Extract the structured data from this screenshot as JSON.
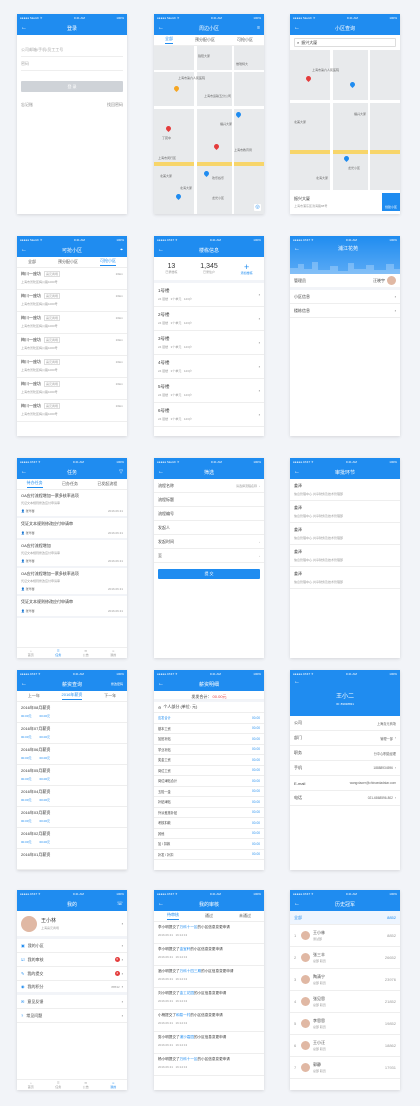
{
  "status": {
    "carrier_a": "●●●●● Sketch ✈",
    "carrier_b": "●●●●● AT&T ✈",
    "time": "9:41 AM",
    "battery": "100%"
  },
  "login": {
    "title": "登录",
    "account_placeholder": "公司邮箱/手机/员工工号",
    "password_placeholder": "密码",
    "login": "登 录",
    "forgot": "忘记账",
    "retrieve": "找回密码"
  },
  "nearby": {
    "title": "周边小区",
    "tabs": [
      "全部",
      "预分配小区",
      "可抢小区"
    ],
    "map_labels": [
      "上海市第六人民医院",
      "上海市运输五分公司",
      "丁苑中",
      "福兴大厦",
      "上海市闵行区",
      "欢乐谷乐",
      "北海大厦",
      "龙光小区",
      "锦阳大厦",
      "上海市教育局",
      "北美大厦",
      "维瑞特大"
    ]
  },
  "search": {
    "title": "小区查询",
    "query": "振兴大厦",
    "map_labels": [
      "上海市第六人民医院",
      "北美大厦",
      "龙光小区",
      "福兴大厦",
      "北海大厦"
    ],
    "result_name": "振兴大厦",
    "result_addr": "上海市浦东区滨海路88号",
    "create": "创建小区"
  },
  "grab": {
    "title": "可抢小区",
    "tabs": [
      "全部",
      "预分配小区",
      "可抢小区"
    ],
    "items": [
      {
        "name": "梅川一座坊",
        "tag": "喜元商场",
        "dist": "16km",
        "addr": "上海市普陀区梅川路1000号"
      },
      {
        "name": "梅川一座坊",
        "tag": "喜元商场",
        "dist": "16km",
        "addr": "上海市普陀区梅川路1000号"
      },
      {
        "name": "梅川一座坊",
        "tag": "喜元商场",
        "dist": "16km",
        "addr": "上海市普陀区梅川路1000号"
      },
      {
        "name": "梅川一座坊",
        "tag": "喜元商场",
        "dist": "16km",
        "addr": "上海市普陀区梅川路1000号"
      },
      {
        "name": "梅川一座坊",
        "tag": "喜元商场",
        "dist": "16km",
        "addr": "上海市普陀区梅川路1000号"
      },
      {
        "name": "梅川一座坊",
        "tag": "喜元商场",
        "dist": "16km",
        "addr": "上海市普陀区梅川路1000号"
      },
      {
        "name": "梅川一座坊",
        "tag": "喜元商场",
        "dist": "16km",
        "addr": "上海市普陀区梅川路1000号"
      }
    ]
  },
  "building": {
    "title": "楼栋信息",
    "stats": [
      {
        "n": "13",
        "l": "已录楼栋"
      },
      {
        "n": "1,345",
        "l": "已录住户"
      }
    ],
    "add": "添加楼栋",
    "rows": [
      {
        "name": "1号楼",
        "meta": "24 层楼   3个单元   123户"
      },
      {
        "name": "2号楼",
        "meta": "24 层楼   3个单元   123户"
      },
      {
        "name": "3号楼",
        "meta": "24 层楼   3个单元   123户"
      },
      {
        "name": "4号楼",
        "meta": "24 层楼   3个单元   123户"
      },
      {
        "name": "5号楼",
        "meta": "24 层楼   3个单元   123户"
      },
      {
        "name": "6号楼",
        "meta": "24 层楼   3个单元   123户"
      }
    ]
  },
  "estate": {
    "title": "浦江花苑",
    "manager_label": "管理员",
    "manager": "汪晓宇",
    "items": [
      "小区信息",
      "楼栋信息"
    ]
  },
  "tasks": {
    "title": "任务",
    "tabs": [
      "待办任务",
      "已办任务",
      "已发起流程"
    ],
    "items": [
      {
        "title": "OA应付流程增加一票多核率选项",
        "desc": "凭证文本规则修改应付申请审",
        "user": "张华馨",
        "date": "2016.06.31"
      },
      {
        "title": "凭证文本规则修改应付申请审",
        "desc": "",
        "user": "张华馨",
        "date": "2016.06.31"
      },
      {
        "title": "OA应付流程增加",
        "desc": "凭证文本规则修改应付申请审",
        "user": "张华馨",
        "date": "2016.06.31"
      },
      {
        "title": "OA应付流程增加一票多核率选项",
        "desc": "凭证文本规则修改应付申请审",
        "user": "张华馨",
        "date": "2016.06.31"
      },
      {
        "title": "凭证文本规则修改应付申请审",
        "desc": "",
        "user": "张华馨",
        "date": "2016.06.31"
      }
    ],
    "bar": [
      "首页",
      "任务",
      "公告",
      "我的"
    ]
  },
  "filter": {
    "title": "筛选",
    "fields": [
      {
        "l": "流程名称",
        "v": "请选择流程名称"
      },
      {
        "l": "流程标题",
        "v": ""
      },
      {
        "l": "流程编号",
        "v": ""
      },
      {
        "l": "发起人",
        "v": ""
      },
      {
        "l": "发起时间",
        "v": ""
      },
      {
        "l": "至",
        "v": ""
      }
    ],
    "confirm": "提 交"
  },
  "approval": {
    "title": "审批环节",
    "items": [
      {
        "n": "姜泽",
        "d": "信息管理中心·共享财务及技术管理部"
      },
      {
        "n": "姜泽",
        "d": "信息管理中心·共享财务及技术管理部"
      },
      {
        "n": "姜泽",
        "d": "信息管理中心·共享财务及技术管理部"
      },
      {
        "n": "姜泽",
        "d": "信息管理中心·共享财务及技术管理部"
      },
      {
        "n": "姜泽",
        "d": "信息管理中心·共享财务及技术管理部"
      }
    ]
  },
  "salary": {
    "title": "薪资查询",
    "right": "修改密码",
    "prev": "上一年",
    "year": "2016年薪资",
    "next": "下一年",
    "items": [
      {
        "m": "2016年08月薪资",
        "a": "00.00元",
        "b": "00.00元"
      },
      {
        "m": "2016年07月薪资",
        "a": "00.00元",
        "b": "00.00元"
      },
      {
        "m": "2016年06月薪资",
        "a": "00.00元",
        "b": "00.00元"
      },
      {
        "m": "2016年05月薪资",
        "a": "00.00元",
        "b": "00.00元"
      },
      {
        "m": "2016年04月薪资",
        "a": "00.00元",
        "b": "00.00元"
      },
      {
        "m": "2016年03月薪资",
        "a": "00.00元",
        "b": "00.00元"
      },
      {
        "m": "2016年02月薪资",
        "a": "00.00元",
        "b": "00.00元"
      },
      {
        "m": "2016年01月薪资",
        "a": "",
        "b": ""
      }
    ]
  },
  "detail": {
    "title": "薪资明细",
    "total_label": "发发合计",
    "total": "00.00元",
    "section": "个人部分 (单位: 元)",
    "rows": [
      {
        "l": "应发合计",
        "v": "00.00"
      },
      {
        "l": "基本工资",
        "v": "00.00"
      },
      {
        "l": "加班补贴",
        "v": "00.00"
      },
      {
        "l": "学业补贴",
        "v": "00.00"
      },
      {
        "l": "奖金工资",
        "v": "00.00"
      },
      {
        "l": "岗位工资",
        "v": "00.00"
      },
      {
        "l": "岗位津贴合计",
        "v": "00.00"
      },
      {
        "l": "五险一金",
        "v": "00.00"
      },
      {
        "l": "补贴津贴",
        "v": "00.00"
      },
      {
        "l": "外派差旅补贴",
        "v": "00.00"
      },
      {
        "l": "考核扣款",
        "v": "00.00"
      },
      {
        "l": "其他",
        "v": "00.00"
      },
      {
        "l": "加 / 扣款",
        "v": "00.00"
      },
      {
        "l": "补发 / 补扣",
        "v": "00.00"
      }
    ]
  },
  "contact": {
    "name": "王小二",
    "id": "ID: 89938831",
    "rows": [
      {
        "l": "公司",
        "v": "上海喜元商场"
      },
      {
        "l": "部门",
        "v": "管理一部"
      },
      {
        "l": "职务",
        "v": "分中心职能经理"
      },
      {
        "l": "手机",
        "v": "18888934596"
      },
      {
        "l": "E-mail",
        "v": "wangxiaoer@chinaedadstar.com"
      },
      {
        "l": "电话",
        "v": "021-6868596-802"
      }
    ]
  },
  "mine": {
    "title": "我的",
    "name": "王小林",
    "company": "上海喜元商场",
    "items": [
      {
        "l": "我的小区",
        "b": ""
      },
      {
        "l": "我的审核",
        "b": "6"
      },
      {
        "l": "我的提交",
        "b": "4"
      },
      {
        "l": "我的积分",
        "b": "88532"
      },
      {
        "l": "意见反馈",
        "b": ""
      },
      {
        "l": "常见问题",
        "b": ""
      }
    ],
    "bar": [
      "首页",
      "任务",
      "公告",
      "我的"
    ]
  },
  "review": {
    "title": "我的审核",
    "tabs": [
      "待审核",
      "通过",
      "未通过"
    ],
    "items": [
      {
        "pre": "李小明提交了",
        "hl": "万科十一区",
        "post": "的小区信息变更申请",
        "t": "2016.06.31   16:14:13"
      },
      {
        "pre": "李小明提交了",
        "hl": "金宝轩",
        "post": "的小区信息变更申请",
        "t": "2016.06.31   16:14:13"
      },
      {
        "pre": "酒小明提交了",
        "hl": "万科十四三期",
        "post": "的小区信息变更申请",
        "t": "2016.06.31   16:14:13"
      },
      {
        "pre": "刘小明提交了",
        "hl": "金工花园",
        "post": "的小区信息变更申请",
        "t": "2016.06.31   16:14:13"
      },
      {
        "pre": "小杨提交了",
        "hl": "和易一村",
        "post": "的小区信息变更申请",
        "t": "2016.06.31   16:14:13"
      },
      {
        "pre": "剪小明提交了",
        "hl": "浦沙嘉园",
        "post": "的小区信息变更申请",
        "t": "2016.06.31   16:14:13"
      },
      {
        "pre": "杨小明提交了",
        "hl": "万科十一区",
        "post": "的小区信息变更申请",
        "t": "2016.06.31   16:14:13"
      }
    ]
  },
  "champion": {
    "title": "历史冠军",
    "me": {
      "rank": "全部",
      "name": "",
      "score": "8852"
    },
    "items": [
      {
        "r": "1",
        "n": "王小林",
        "d": "测试部",
        "s": "8852"
      },
      {
        "r": "2",
        "n": "张三丰",
        "d": "总部 职员",
        "s": "26652"
      },
      {
        "r": "3",
        "n": "陶清宁",
        "d": "总部 职员",
        "s": "23976"
      },
      {
        "r": "4",
        "n": "张见思",
        "d": "总部 职员",
        "s": "21852"
      },
      {
        "r": "5",
        "n": "李思思",
        "d": "总部 职员",
        "s": "19852"
      },
      {
        "r": "6",
        "n": "王小汪",
        "d": "总部 职员",
        "s": "18862"
      },
      {
        "r": "7",
        "n": "郭静",
        "d": "总部 职员",
        "s": "17931"
      }
    ]
  }
}
